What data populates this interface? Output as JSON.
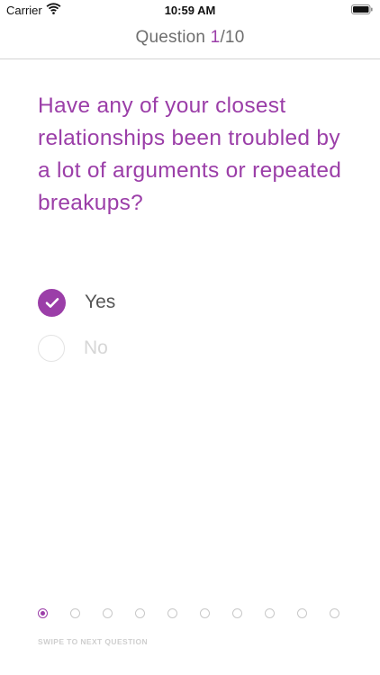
{
  "status_bar": {
    "carrier": "Carrier",
    "time": "10:59 AM",
    "wifi_icon": "wifi-icon",
    "battery_icon": "battery-icon"
  },
  "header": {
    "title_prefix": "Question ",
    "current": "1",
    "total_suffix": "/10"
  },
  "question": {
    "text": "Have any of your closest relationships been troubled by a lot of arguments or repeated breakups?"
  },
  "options": [
    {
      "label": "Yes",
      "selected": true,
      "icon": "checkmark-icon"
    },
    {
      "label": "No",
      "selected": false,
      "icon": "radio-empty-icon"
    }
  ],
  "pagination": {
    "total": 10,
    "active_index": 0
  },
  "footer": {
    "hint": "SWIPE TO NEXT QUESTION"
  },
  "colors": {
    "accent": "#9b3ea8",
    "muted_text": "#6e6e6e",
    "disabled_text": "#d6d6d6"
  }
}
